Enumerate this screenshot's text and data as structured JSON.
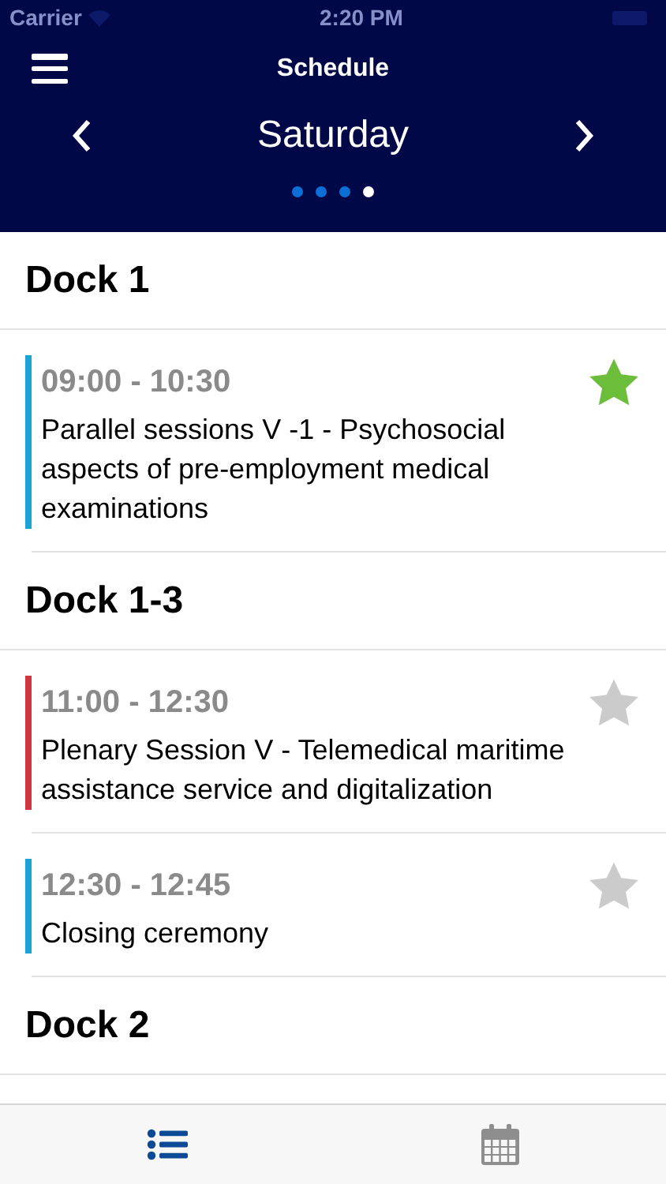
{
  "status_bar": {
    "carrier": "Carrier",
    "time": "2:20 PM"
  },
  "header": {
    "title": "Schedule",
    "day": "Saturday",
    "pages": [
      {
        "selected": false
      },
      {
        "selected": false
      },
      {
        "selected": false
      },
      {
        "selected": true
      }
    ]
  },
  "sections": [
    {
      "title": "Dock 1",
      "sessions": [
        {
          "time": "09:00 - 10:30",
          "title": "Parallel sessions V -1 - Psychosocial aspects of pre-employment medical examinations",
          "color": "#1aa3d6",
          "starred": true
        }
      ]
    },
    {
      "title": "Dock 1-3",
      "sessions": [
        {
          "time": "11:00 - 12:30",
          "title": "Plenary Session V - Telemedical maritime assistance service and digitalization",
          "color": "#d0343f",
          "starred": false
        },
        {
          "time": "12:30 - 12:45",
          "title": "Closing ceremony",
          "color": "#1aa3d6",
          "starred": false
        }
      ]
    },
    {
      "title": "Dock 2"
    }
  ],
  "tab_bar": [
    {
      "kind": "list",
      "selected": true
    },
    {
      "kind": "calendar",
      "selected": false
    }
  ]
}
